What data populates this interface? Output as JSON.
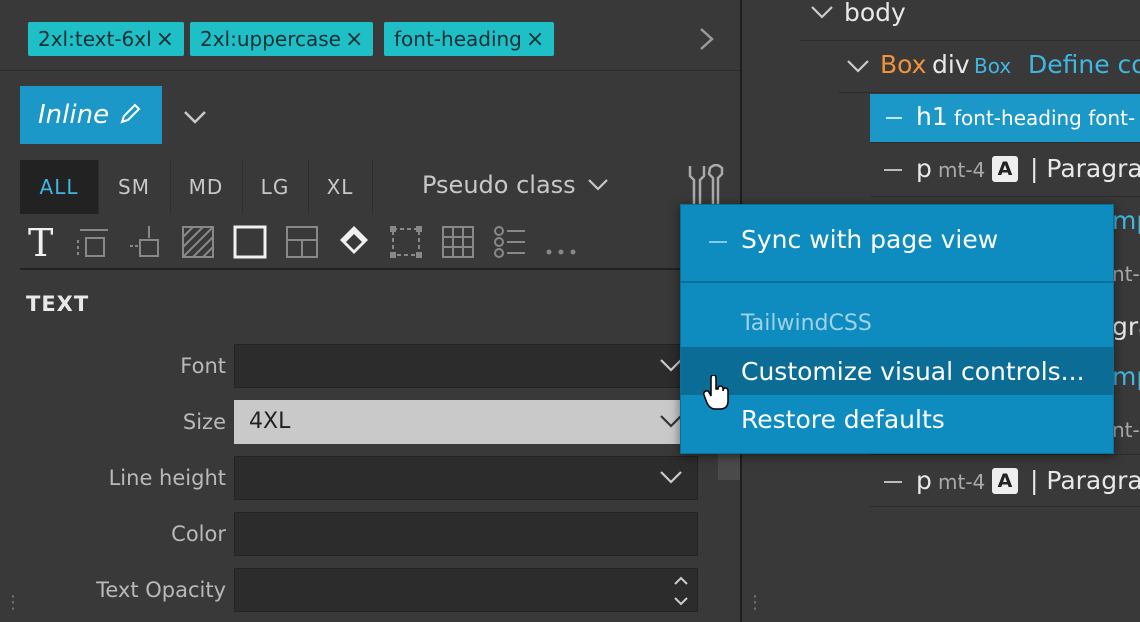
{
  "tags": [
    {
      "label": "2xl:text-6xl"
    },
    {
      "label": "2xl:uppercase"
    },
    {
      "label": "font-heading"
    }
  ],
  "inline_button": {
    "label": "Inline"
  },
  "breakpoints": [
    "ALL",
    "SM",
    "MD",
    "LG",
    "XL"
  ],
  "pseudo_class": {
    "label": "Pseudo class"
  },
  "section": {
    "title": "TEXT"
  },
  "fields": [
    {
      "label": "Font",
      "value": ""
    },
    {
      "label": "Size",
      "value": "4XL"
    },
    {
      "label": "Line height",
      "value": ""
    },
    {
      "label": "Color",
      "value": ""
    },
    {
      "label": "Text Opacity",
      "value": ""
    }
  ],
  "tree": {
    "body": "body",
    "box_row": {
      "name": "Box",
      "tag": "div",
      "component": "Box",
      "desc": "Define co"
    },
    "h1_row": {
      "tag": "h1",
      "classes": "font-heading font-"
    },
    "p_rows": [
      {
        "tag": "p",
        "classes": "mt-4",
        "badge": "A",
        "text": "| Paragra"
      },
      {
        "tag": "p",
        "classes": "mt-4",
        "badge": "A",
        "text": "| Paragra"
      }
    ],
    "partial_rows": [
      "mp",
      "nt-",
      "gra",
      "mp",
      "nt-"
    ]
  },
  "menu": {
    "sync": "Sync with page view",
    "group": "TailwindCSS",
    "customize": "Customize visual controls...",
    "restore": "Restore defaults"
  },
  "colors": {
    "accent": "#1b98c8",
    "tag_bg": "#1fbfc7",
    "menu_bg": "#0e8cc0",
    "menu_highlight": "#0b6d95",
    "tree_orange": "#f0923a",
    "tree_blue": "#3fb7e3"
  }
}
